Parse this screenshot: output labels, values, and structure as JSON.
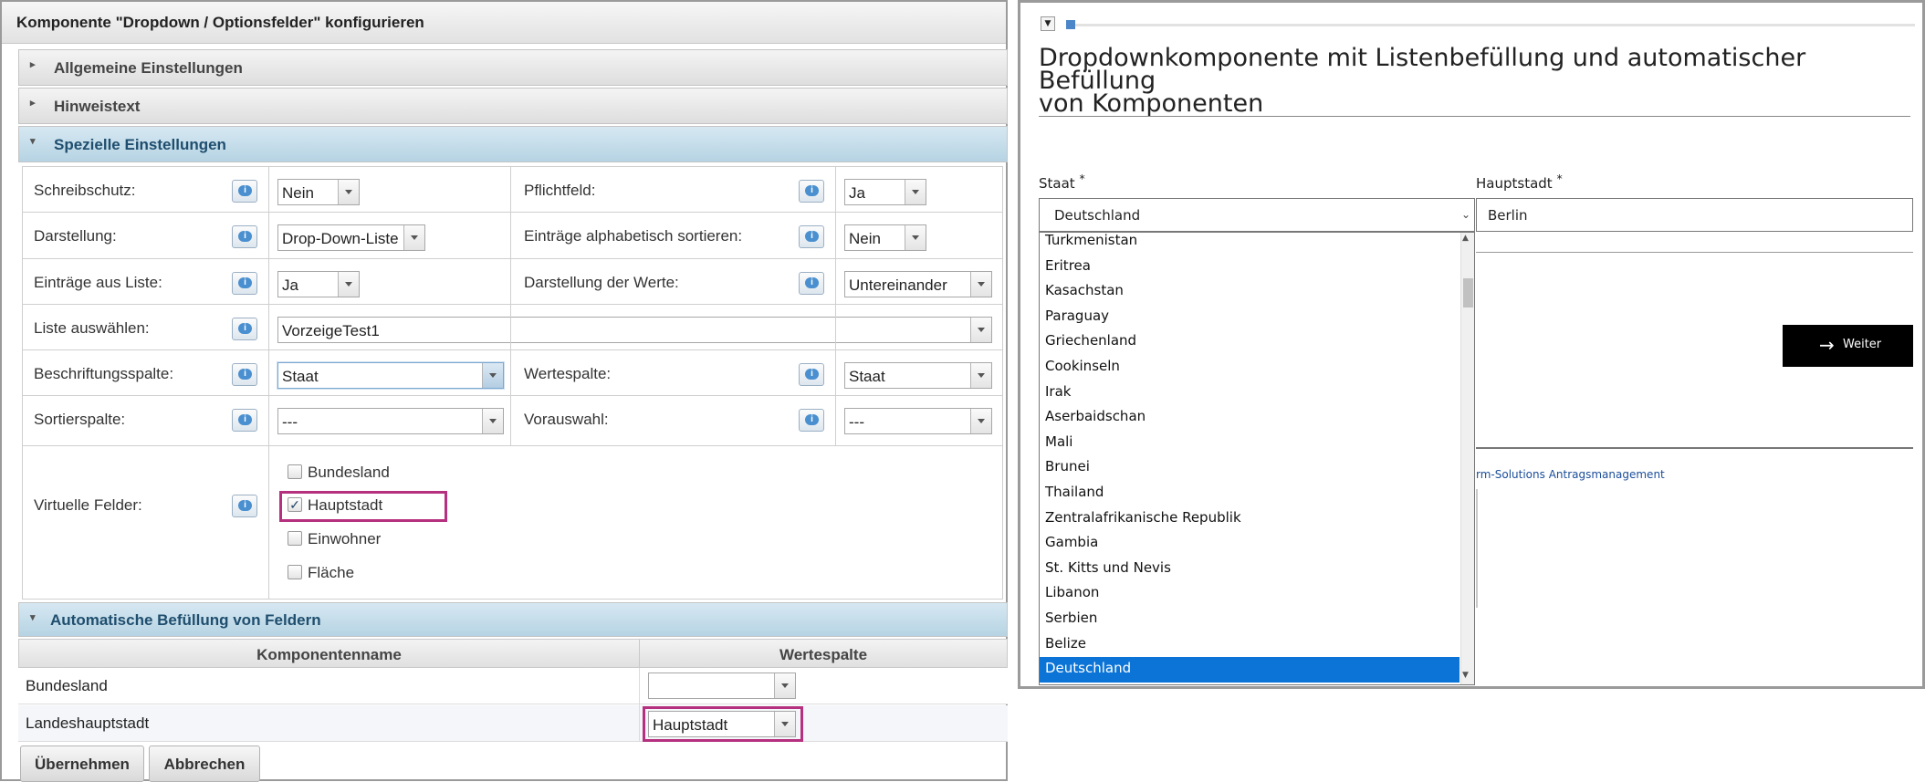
{
  "dialog": {
    "title": "Komponente \"Dropdown / Optionsfelder\" konfigurieren",
    "sections": {
      "general": "Allgemeine Einstellungen",
      "hint": "Hinweistext",
      "special": "Spezielle Einstellungen",
      "autofill": "Automatische Befüllung von Feldern"
    },
    "fields": {
      "schreibschutz": {
        "label": "Schreibschutz:",
        "value": "Nein"
      },
      "pflichtfeld": {
        "label": "Pflichtfeld:",
        "value": "Ja"
      },
      "darstellung": {
        "label": "Darstellung:",
        "value": "Drop-Down-Liste"
      },
      "sortieren": {
        "label": "Einträge alphabetisch sortieren:",
        "value": "Nein"
      },
      "aus_liste": {
        "label": "Einträge aus Liste:",
        "value": "Ja"
      },
      "darstellung_werte": {
        "label": "Darstellung der Werte:",
        "value": "Untereinander"
      },
      "liste": {
        "label": "Liste auswählen:",
        "value": "VorzeigeTest1"
      },
      "beschriftung": {
        "label": "Beschriftungsspalte:",
        "value": "Staat"
      },
      "wertespalte": {
        "label": "Wertespalte:",
        "value": "Staat"
      },
      "sortierspalte": {
        "label": "Sortierspalte:",
        "value": "---"
      },
      "vorauswahl": {
        "label": "Vorauswahl:",
        "value": "---"
      },
      "virtuelle": {
        "label": "Virtuelle Felder:"
      }
    },
    "virtual_fields": [
      {
        "label": "Bundesland",
        "checked": false
      },
      {
        "label": "Hauptstadt",
        "checked": true
      },
      {
        "label": "Einwohner",
        "checked": false
      },
      {
        "label": "Fläche",
        "checked": false
      }
    ],
    "grid": {
      "col1": "Komponentenname",
      "col2": "Wertespalte",
      "rows": [
        {
          "name": "Bundesland",
          "value": ""
        },
        {
          "name": "Landeshauptstadt",
          "value": "Hauptstadt"
        }
      ]
    },
    "buttons": {
      "apply": "Übernehmen",
      "cancel": "Abbrechen"
    }
  },
  "preview": {
    "heading_line1": "Dropdownkomponente mit Listenbefüllung und automatischer Befüllung",
    "heading_line2": "von Komponenten",
    "staat_label": "Staat",
    "hauptstadt_label": "Hauptstadt",
    "required_mark": "*",
    "staat_value": "Deutschland",
    "hauptstadt_value": "Berlin",
    "weiter_label": "Weiter",
    "footer_link": "rm-Solutions Antragsmanagement",
    "dropdown_options": [
      "Turkmenistan",
      "Eritrea",
      "Kasachstan",
      "Paraguay",
      "Griechenland",
      "Cookinseln",
      "Irak",
      "Aserbaidschan",
      "Mali",
      "Brunei",
      "Thailand",
      "Zentralafrikanische Republik",
      "Gambia",
      "St. Kitts und Nevis",
      "Libanon",
      "Serbien",
      "Belize",
      "Deutschland"
    ],
    "selected_option": "Deutschland"
  },
  "colors": {
    "highlight": "#b5307e",
    "selection": "#0b74d6",
    "section_open": "#b6d3e3"
  }
}
